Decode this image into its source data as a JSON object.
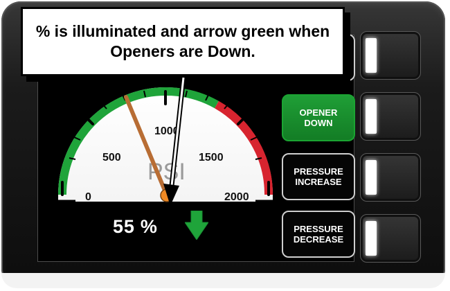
{
  "callout": {
    "text": "% is illuminated and arrow green when Openers are Down."
  },
  "gauge": {
    "tick_labels": {
      "t0": "0",
      "t500": "500",
      "t1000": "1000",
      "t1500": "1500",
      "t2000": "2000"
    },
    "unit": "PSI",
    "value": 1000,
    "min": 0,
    "max": 2000
  },
  "status": {
    "percent_text": "55 %",
    "arrow_icon": "down-arrow-icon"
  },
  "buttons": [
    {
      "label_line1": "",
      "label_line2": ""
    },
    {
      "label_line1": "OPENER",
      "label_line2": "DOWN"
    },
    {
      "label_line1": "PRESSURE",
      "label_line2": "INCREASE"
    },
    {
      "label_line1": "PRESSURE",
      "label_line2": "DECREASE"
    }
  ],
  "colors": {
    "green": "#1fa43a",
    "red": "#d7242f",
    "needle": "#b86d34",
    "accent": "#1ba432"
  }
}
